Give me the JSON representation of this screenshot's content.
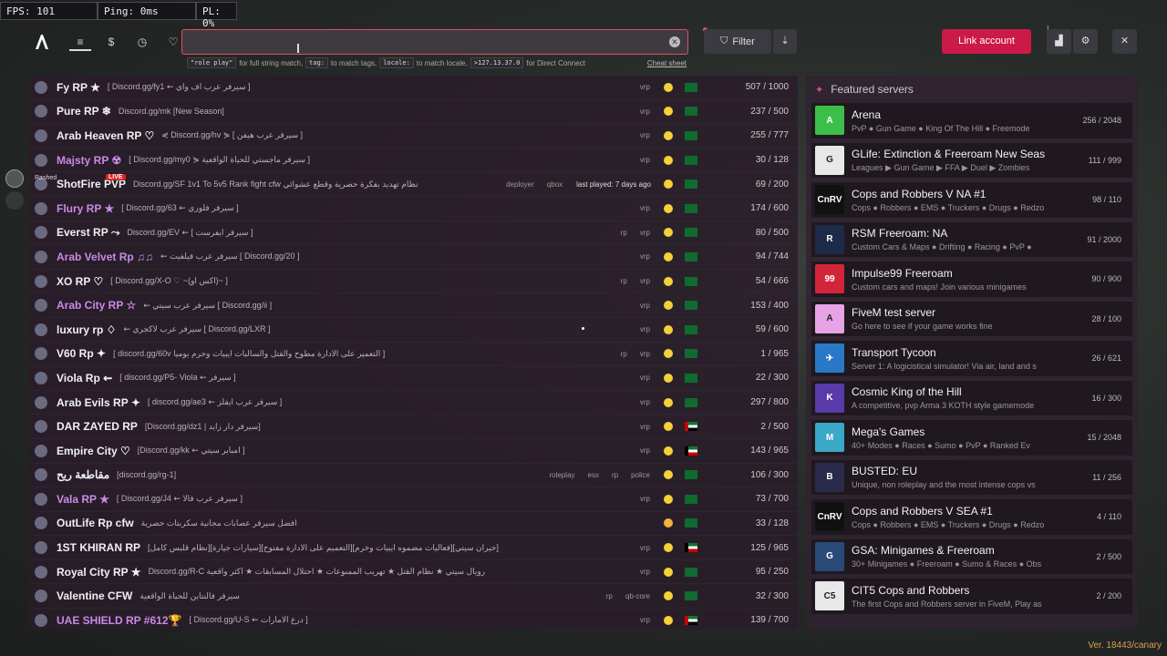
{
  "overlay": {
    "fps": "FPS: 101",
    "ping": "Ping: 0ms",
    "pl": "PL: 0%"
  },
  "search": {
    "value": "",
    "placeholder": ""
  },
  "hints": {
    "c1": "\"role play\"",
    "t1": "for full string match,",
    "c2": "tag:",
    "t2": "to match tags,",
    "c3": "locale:",
    "t3": "to match locale,",
    "c4": ">127.13.37.0",
    "t4": "for Direct Connect",
    "cheat": "Cheat sheet"
  },
  "toolbar": {
    "filter": "Filter",
    "link": "Link account",
    "badge": "1"
  },
  "live": {
    "name": "Rashed",
    "tag": "LIVE"
  },
  "servers": [
    {
      "name": "Fy RP ★",
      "desc": "[ Discord.gg/fy1 ⇜ سيرفر عرب اف واي ]",
      "tags": [
        "vrp"
      ],
      "count": "507 / 1000",
      "flag": "sa"
    },
    {
      "name": "Pure RP ❄",
      "desc": "Discord.gg/mk [New Season]",
      "tags": [
        "vrp"
      ],
      "count": "237 / 500",
      "flag": "sa"
    },
    {
      "name": "Arab Heaven RP ♡",
      "desc": "⋞ Discord.gg/hv ⋟ [ سيرفر عرب هيفن ]",
      "tags": [
        "vrp"
      ],
      "count": "255 / 777",
      "flag": "sa"
    },
    {
      "name": "Majsty RP ☢",
      "desc": "[ Discord.gg/my0 ⋟ سيرفر ماجستي للحياة الواقعية ]",
      "tags": [
        "vrp"
      ],
      "count": "30 / 128",
      "flag": "sa",
      "purple": true
    },
    {
      "name": "ShotFire PVP",
      "desc": "Discord.gg/SF 1v1 To 5v5 Rank fight cfw نظام تهديد بفكرة حصرية وقطع عشوائي",
      "tags": [
        "deployer",
        "qbox"
      ],
      "lastPlayed": "last played: 7 days ago",
      "count": "69 / 200",
      "flag": "sa"
    },
    {
      "name": "Flury RP ★",
      "desc": "[ Discord.gg/63 ⇜ سيرفر فلوري ]",
      "tags": [
        "vrp"
      ],
      "count": "174 / 600",
      "flag": "sa",
      "purple": true
    },
    {
      "name": "Everst RP ⤳",
      "desc": "Discord.gg/EV ⇜ [ سيرفر ايفرست ]",
      "tags": [
        "rp",
        "vrp"
      ],
      "count": "80 / 500",
      "flag": "sa"
    },
    {
      "name": "Arab Velvet Rp ♫♫",
      "desc": "⇜ سيرفر عرب فيلفيت [ Discord.gg/20 ]",
      "tags": [
        "vrp"
      ],
      "count": "94 / 744",
      "flag": "sa",
      "purple": true
    },
    {
      "name": "XO RP ♡",
      "desc": "[ Discord.gg/X-O ♡ ~(اكس او)~ ]",
      "tags": [
        "rp",
        "vrp"
      ],
      "count": "54 / 666",
      "flag": "sa"
    },
    {
      "name": "Arab City RP ☆",
      "desc": "⇜ سيرفر عرب سيتي [ Discord.gg/ii ]",
      "tags": [
        "vrp"
      ],
      "count": "153 / 400",
      "flag": "sa",
      "purple": true
    },
    {
      "name": "luxury rp ♢",
      "desc": "⇜ سيرفر عرب لاكجري [ Discord.gg/LXR ]",
      "tags": [
        "vrp"
      ],
      "count": "59 / 600",
      "flag": "sa"
    },
    {
      "name": "V60 Rp ✦",
      "desc": "[ discord.gg/60v التعمير على الادارة مطوح والقتل والسالبات ايبيات وحرم يوميا ]",
      "tags": [
        "rp",
        "vrp"
      ],
      "count": "1 / 965",
      "flag": "sa"
    },
    {
      "name": "Viola Rp ⇜",
      "desc": "[ discord.gg/P5- Viola ⇜ سيرفر ]",
      "tags": [
        "vrp"
      ],
      "count": "22 / 300",
      "flag": "sa"
    },
    {
      "name": "Arab Evils RP ✦",
      "desc": "[ discord.gg/ae3 ⇜ سيرفر عرب ايفلز ]",
      "tags": [
        "vrp"
      ],
      "count": "297 / 800",
      "flag": "sa"
    },
    {
      "name": "DAR ZAYED RP",
      "desc": "[Discord.gg/dz1 | سيرفر دار زايد]",
      "tags": [
        "vrp"
      ],
      "count": "2 / 500",
      "flag": "uae"
    },
    {
      "name": "Empire City ♡",
      "desc": "[Discord.gg/kk ⇜ امباير سيتي ]",
      "tags": [
        "vrp"
      ],
      "count": "143 / 965",
      "flag": "kw"
    },
    {
      "name": "مقاطعة ريح",
      "desc": "[discord.gg/rg-1]",
      "tags": [
        "roleplay",
        "esx",
        "rp",
        "police"
      ],
      "count": "106 / 300",
      "flag": "sa"
    },
    {
      "name": "Vala RP ★",
      "desc": "[ Discord.gg/J4 ⇜ سيرفر عرب فالا ]",
      "tags": [
        "vrp"
      ],
      "count": "73 / 700",
      "flag": "sa",
      "purple": true
    },
    {
      "name": "OutLife Rp cfw",
      "desc": "افضل سيرفر عصابات مجانية سكربتات حصرية",
      "tags": [],
      "count": "33 / 128",
      "flag": "sa",
      "orange": true
    },
    {
      "name": "1ST KHIRAN RP",
      "desc": "[نظام قلبس كامل][سيارات جيارة][التعميم على الادارة مفتوح][فعاليات مضموه ايبيات وخرم][خيران سيتي]",
      "tags": [
        "vrp"
      ],
      "count": "125 / 965",
      "flag": "kw"
    },
    {
      "name": "Royal City RP ★",
      "desc": "Discord.gg/R-C رويال سيتي ★ نظام القتل ★ تهريب الممنوعات ★ احتلال المسابقات ★ اكثر واقعية",
      "tags": [
        "vrp"
      ],
      "count": "95 / 250",
      "flag": "sa"
    },
    {
      "name": "Valentine CFW",
      "desc": "سيرفر فالنتاين للحياة الواقعية",
      "tags": [
        "rp",
        "qb-core"
      ],
      "count": "32 / 300",
      "flag": "sa"
    },
    {
      "name": "UAE SHIELD RP #612🏆",
      "desc": "[ Discord.gg/U-S ⇜ درع الامارات ]",
      "tags": [
        "vrp"
      ],
      "count": "139 / 700",
      "flag": "uae",
      "purple": true
    }
  ],
  "featured": {
    "title": "Featured servers",
    "items": [
      {
        "name": "Arena",
        "desc": "PvP ● Gun Game ● King Of The Hill ● Freemode",
        "count": "256 / 2048",
        "logo": "A",
        "color": "#3bbf4a"
      },
      {
        "name": "GLife: Extinction & Freeroam New Seas",
        "desc": "Leagues ▶ Gun Game ▶ FFA ▶ Duel ▶ Zombies",
        "count": "111 / 999",
        "logo": "G",
        "color": "#e8e8e8"
      },
      {
        "name": "Cops and Robbers V NA #1",
        "desc": "Cops ● Robbers ● EMS ● Truckers ● Drugs ● Redzo",
        "count": "98 / 110",
        "logo": "CnRV",
        "color": "#111111"
      },
      {
        "name": "RSM Freeroam: NA",
        "desc": "Custom Cars & Maps ● Drifting ● Racing ● PvP ●",
        "count": "91 / 2000",
        "logo": "R",
        "color": "#1e2a4a"
      },
      {
        "name": "Impulse99 Freeroam",
        "desc": "Custom cars and maps! Join various minigames",
        "count": "90 / 900",
        "logo": "99",
        "color": "#d3253a"
      },
      {
        "name": "FiveM test server",
        "desc": "Go here to see if your game works fine",
        "count": "28 / 100",
        "logo": "A",
        "color": "#e6a3e6"
      },
      {
        "name": "Transport Tycoon",
        "desc": "Server 1: A logicistical simulator! Via air, land and s",
        "count": "26 / 621",
        "logo": "✈",
        "color": "#2a78c8"
      },
      {
        "name": "Cosmic King of the Hill",
        "desc": "A competitive, pvp Arma 3 KOTH style gamemode",
        "count": "16 / 300",
        "logo": "K",
        "color": "#5a3aa8"
      },
      {
        "name": "Mega's Games",
        "desc": "40+ Modes ● Races ● Sumo ● PvP ● Ranked Ev",
        "count": "15 / 2048",
        "logo": "M",
        "color": "#3aa8c8"
      },
      {
        "name": "BUSTED: EU",
        "desc": "Unique, non roleplay and the most intense cops vs",
        "count": "11 / 256",
        "logo": "B",
        "color": "#2a2a4a"
      },
      {
        "name": "Cops and Robbers V SEA #1",
        "desc": "Cops ● Robbers ● EMS ● Truckers ● Drugs ● Redzo",
        "count": "4 / 110",
        "logo": "CnRV",
        "color": "#111111"
      },
      {
        "name": "GSA: Minigames & Freeroam",
        "desc": "30+ Minigames ● Freeroam ● Sumo & Races ● Obs",
        "count": "2 / 500",
        "logo": "G",
        "color": "#2a4a78"
      },
      {
        "name": "CIT5 Cops and Robbers",
        "desc": "The first Cops and Robbers server in FiveM, Play as",
        "count": "2 / 200",
        "logo": "C5",
        "color": "#e8e8e8"
      }
    ]
  },
  "version": "Ver. 18443/canary"
}
